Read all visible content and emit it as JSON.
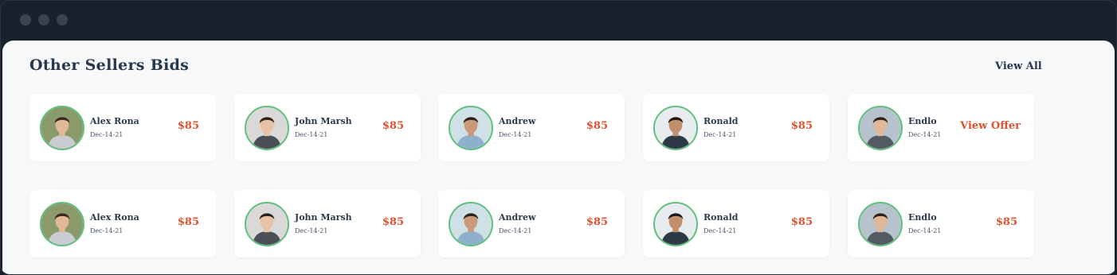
{
  "window": {
    "controls": [
      "close",
      "minimize",
      "maximize"
    ]
  },
  "section": {
    "title": "Other Sellers Bids",
    "view_all_label": "View All"
  },
  "colors": {
    "accent": "#e0512e",
    "avatar_ring": "#5fbf7c",
    "heading": "#27384d",
    "chrome": "#18212c"
  },
  "rows": [
    [
      {
        "name": "Alex Rona",
        "date": "Dec-14-21",
        "price": "$85",
        "avatar_icon": "user-avatar-icon"
      },
      {
        "name": "John Marsh",
        "date": "Dec-14-21",
        "price": "$85",
        "avatar_icon": "user-avatar-icon"
      },
      {
        "name": "Andrew",
        "date": "Dec-14-21",
        "price": "$85",
        "avatar_icon": "user-avatar-icon"
      },
      {
        "name": "Ronald",
        "date": "Dec-14-21",
        "price": "$85",
        "avatar_icon": "user-avatar-icon"
      },
      {
        "name": "Endlo",
        "date": "Dec-14-21",
        "price": "View Offer",
        "avatar_icon": "user-avatar-icon"
      }
    ],
    [
      {
        "name": "Alex Rona",
        "date": "Dec-14-21",
        "price": "$85",
        "avatar_icon": "user-avatar-icon"
      },
      {
        "name": "John Marsh",
        "date": "Dec-14-21",
        "price": "$85",
        "avatar_icon": "user-avatar-icon"
      },
      {
        "name": "Andrew",
        "date": "Dec-14-21",
        "price": "$85",
        "avatar_icon": "user-avatar-icon"
      },
      {
        "name": "Ronald",
        "date": "Dec-14-21",
        "price": "$85",
        "avatar_icon": "user-avatar-icon"
      },
      {
        "name": "Endlo",
        "date": "Dec-14-21",
        "price": "$85",
        "avatar_icon": "user-avatar-icon"
      }
    ]
  ]
}
